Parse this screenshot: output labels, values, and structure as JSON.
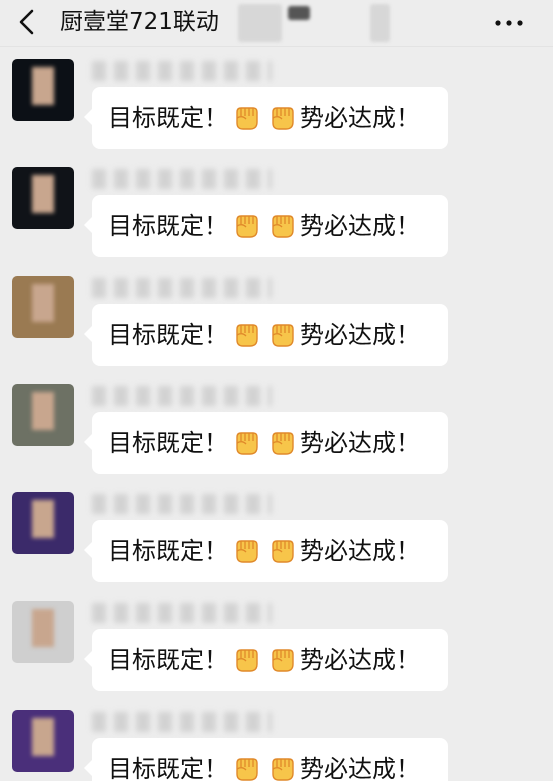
{
  "header": {
    "title": "厨壹堂721联动"
  },
  "message_text": {
    "before": "目标既定！",
    "after": "势必达成！"
  },
  "messages": [
    {
      "avatar_color": "#0c1016"
    },
    {
      "avatar_color": "#101318"
    },
    {
      "avatar_color": "#9a7a52"
    },
    {
      "avatar_color": "#6d7164"
    },
    {
      "avatar_color": "#3b2a6a"
    },
    {
      "avatar_color": "#cfcfcf"
    },
    {
      "avatar_color": "#4a2f7a"
    }
  ],
  "colors": {
    "background": "#ededed",
    "bubble": "#ffffff",
    "fist_fill": "#f7c54a",
    "fist_stroke": "#e0892a"
  },
  "icons": [
    "back-icon",
    "more-icon",
    "fist-emoji-icon"
  ]
}
